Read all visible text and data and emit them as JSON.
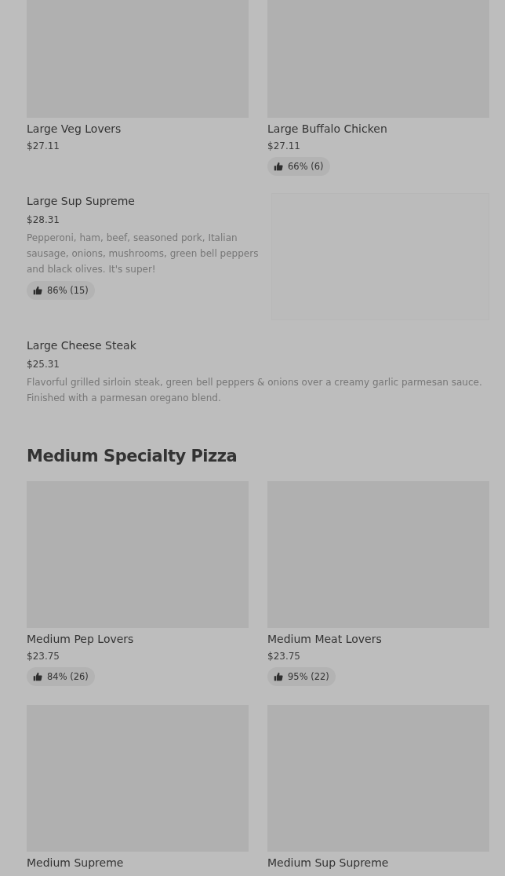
{
  "sections": [
    {
      "kind": "grid",
      "items": [
        {
          "name": "Large Veg Lovers",
          "price": "$27.11"
        },
        {
          "name": "Large Buffalo Chicken",
          "price": "$27.11",
          "rating": "66% (6)"
        }
      ]
    },
    {
      "kind": "list",
      "items": [
        {
          "name": "Large Sup Supreme",
          "price": "$28.31",
          "description": "Pepperoni, ham, beef, seasoned pork, Italian sausage, onions, mushrooms, green bell peppers and black olives. It's super!",
          "rating": "86% (15)",
          "image": true
        },
        {
          "name": "Large Cheese Steak",
          "price": "$25.31",
          "description": "Flavorful grilled sirloin steak, green bell peppers & onions over a creamy garlic parmesan sauce. Finished with a parmesan oregano blend.",
          "image": false
        }
      ]
    },
    {
      "kind": "grid",
      "title": "Medium Specialty Pizza",
      "items": [
        {
          "name": "Medium Pep Lovers",
          "price": "$23.75",
          "rating": "84% (26)"
        },
        {
          "name": "Medium Meat Lovers",
          "price": "$23.75",
          "rating": "95% (22)"
        },
        {
          "name": "Medium Supreme"
        },
        {
          "name": "Medium Sup Supreme"
        }
      ]
    }
  ]
}
